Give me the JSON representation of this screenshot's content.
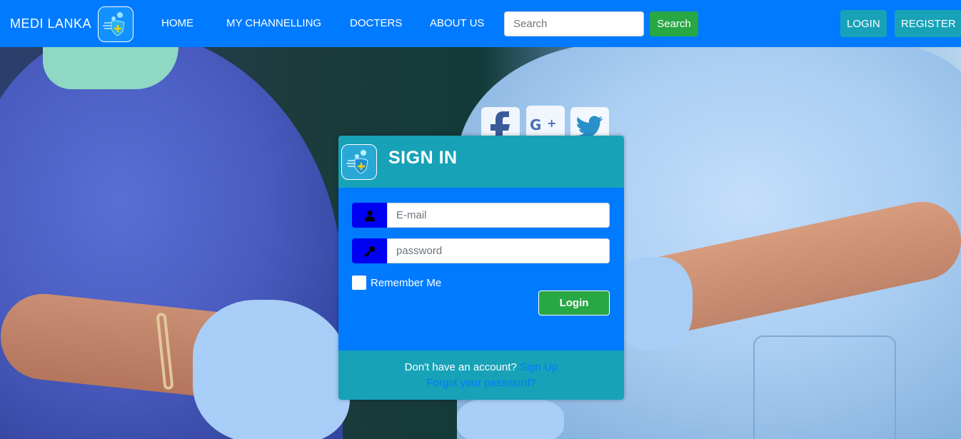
{
  "navbar": {
    "brand": "MEDI LANKA",
    "links": [
      "HOME",
      "MY CHANNELLING",
      "DOCTERS",
      "ABOUT US"
    ],
    "search_placeholder": "Search",
    "search_button": "Search",
    "login_button": "LOGIN",
    "register_button": "REGISTER"
  },
  "social": [
    "facebook-icon",
    "google-plus-icon",
    "twitter-icon"
  ],
  "card": {
    "title": "SIGN IN",
    "email_placeholder": "E-mail",
    "password_placeholder": "password",
    "remember_label": "Remember Me",
    "login_button": "Login",
    "footer_text": "Don't have an account?",
    "signup_link": "Sign Up",
    "forgot_link": "Forgot your password?"
  },
  "colors": {
    "navbar": "#007bff",
    "teal": "#17a2b8",
    "green": "#28a745",
    "icon_blue": "#0000f2"
  }
}
